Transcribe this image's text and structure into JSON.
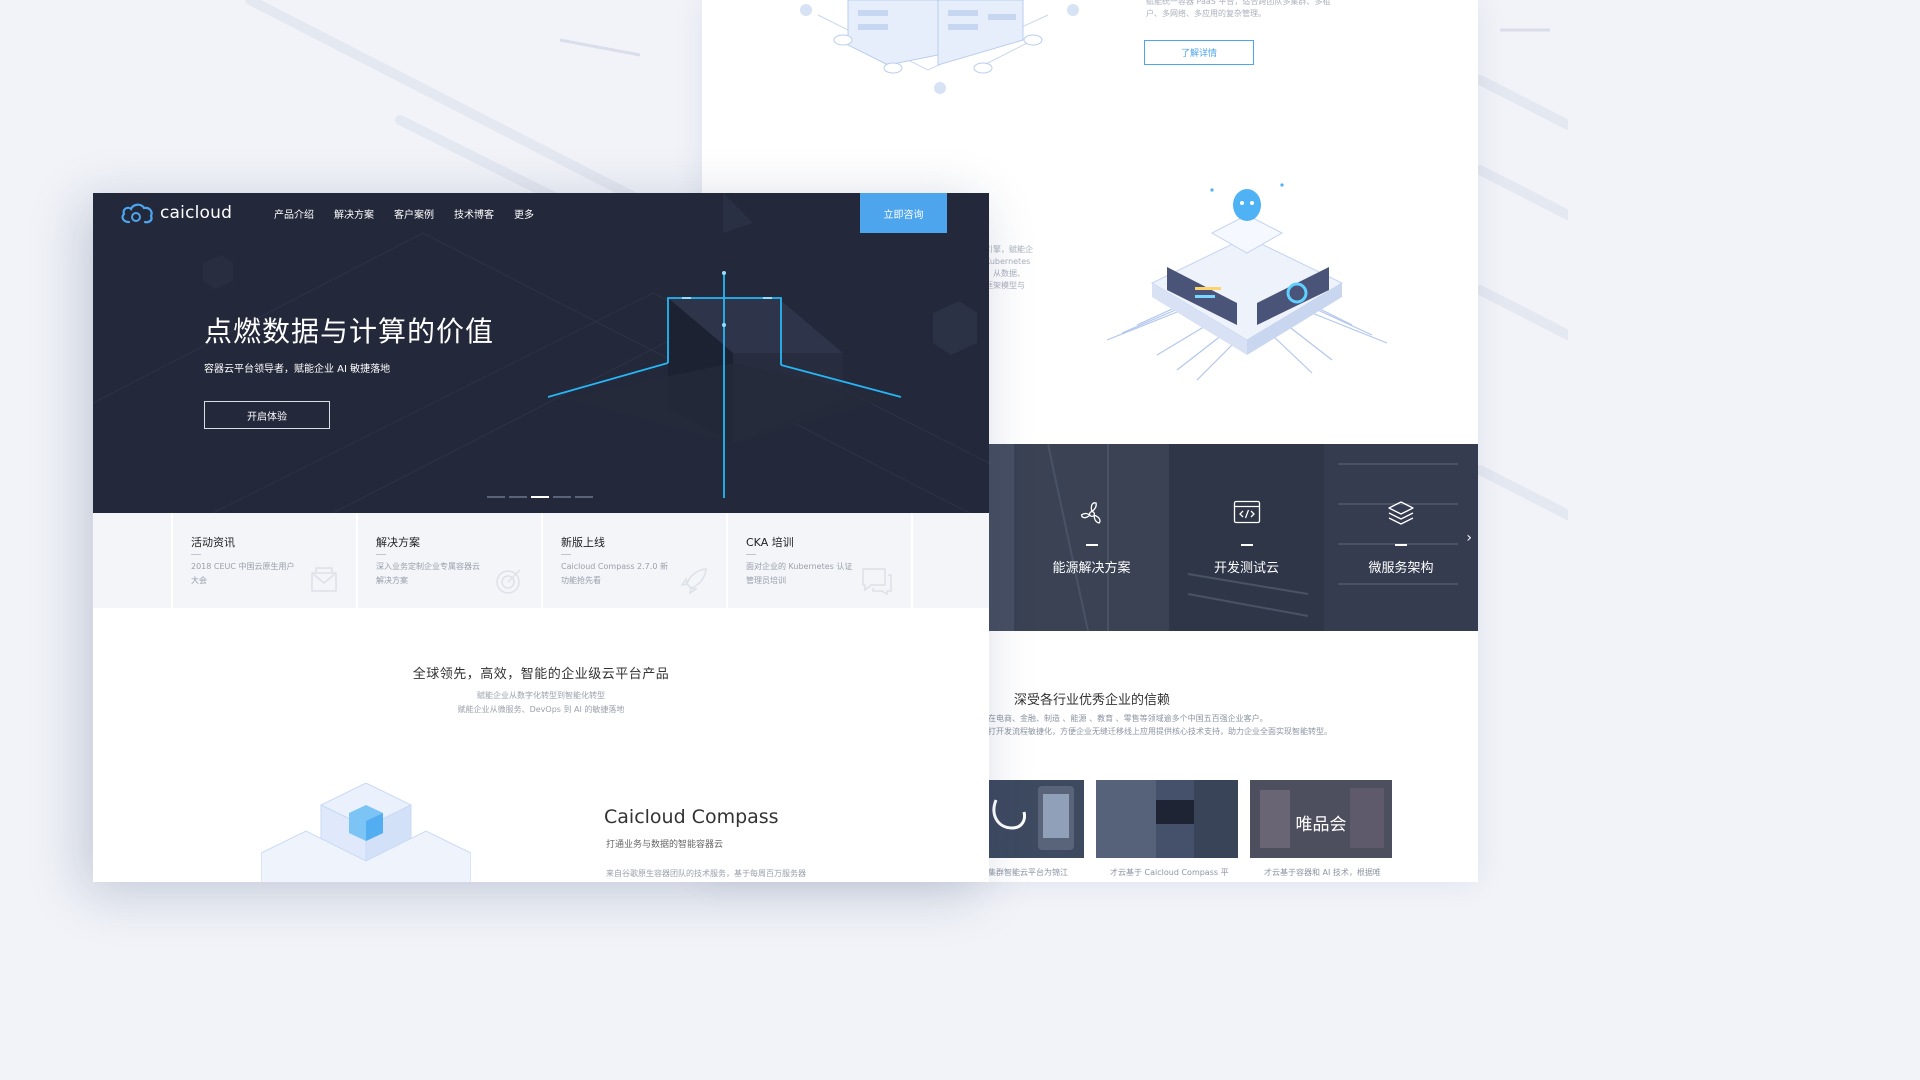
{
  "right_page": {
    "top_desc_lines": [
      "赋能统一容器 PaaS 平台，适合跨团队多集群、多租",
      "户、多网络、多应用的复杂管理。"
    ],
    "learn_more_label": "了解详情",
    "side_text_lines": [
      "引擎，赋能企",
      "Kubernetes",
      "，从数据、",
      "框架模型与"
    ],
    "solutions": [
      {
        "label": "能源解决方案",
        "icon": "turbine-icon"
      },
      {
        "label": "开发测试云",
        "icon": "code-window-icon"
      },
      {
        "label": "微服务架构",
        "icon": "layers-icon"
      }
    ],
    "trust": {
      "title": "深受各行业优秀企业的信赖",
      "sub_lines": [
        "在电商、金融、制造 、能源 、教育 、零售等领域逾多个中国五百强企业客户。",
        "打开发流程敏捷化，方便企业无缝迁移线上应用提供核心技术支持，助力企业全面实现智能转型。"
      ]
    },
    "cases": [
      {
        "card_text": "",
        "caption": "集群智能云平台为锦江"
      },
      {
        "card_text": "",
        "caption": "才云基于 Caicloud Compass 平"
      },
      {
        "card_text": "唯品会",
        "caption": "才云基于容器和 AI 技术，根据唯"
      }
    ]
  },
  "front_page": {
    "brand": "caicloud",
    "nav": [
      "产品介绍",
      "解决方案",
      "客户案例",
      "技术博客",
      "更多"
    ],
    "cta_label": "立即咨询",
    "hero": {
      "title": "点燃数据与计算的价值",
      "subtitle": "容器云平台领导者，赋能企业 AI 敏捷落地",
      "button_label": "开启体验",
      "carousel_total": 5,
      "carousel_active": 3
    },
    "news": [
      {
        "title": "活动资讯",
        "desc": "2018 CEUC 中国云原生用户大会",
        "icon": "envelope-icon"
      },
      {
        "title": "解决方案",
        "desc": "深入业务定制企业专属容器云解决方案",
        "icon": "target-icon"
      },
      {
        "title": "新版上线",
        "desc": "Caicloud Compass 2.7.0 新功能抢先看",
        "icon": "rocket-icon"
      },
      {
        "title": "CKA 培训",
        "desc": "面对企业的 Kubernetes 认证管理员培训",
        "icon": "chat-icon"
      }
    ],
    "section": {
      "title": "全球领先，高效，智能的企业级云平台产品",
      "sub_lines": [
        "赋能企业从数字化转型到智能化转型",
        "赋能企业从微服务、DevOps 到 AI 的敏捷落地"
      ]
    },
    "compass": {
      "title": "Caicloud Compass",
      "subtitle": "打通业务与数据的智能容器云",
      "desc": "来自谷歌原生容器团队的技术服务，基于每周百万服务器"
    }
  },
  "colors": {
    "accent": "#4da5ee",
    "hero_bg": "#23283a",
    "glow": "#27b6f5",
    "dark_panel": "#2d3446"
  }
}
